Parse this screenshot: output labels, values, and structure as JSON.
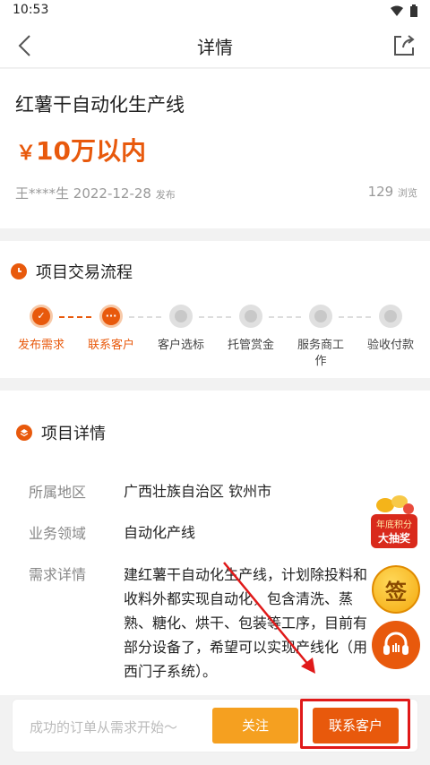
{
  "status_bar": {
    "time": "10:53"
  },
  "nav": {
    "title": "详情"
  },
  "project": {
    "title": "红薯干自动化生产线",
    "price_currency": "￥",
    "price_amount": "10万以内",
    "poster": "王****生",
    "date": "2022-12-28",
    "date_suffix": "发布",
    "views": "129",
    "views_suffix": "浏览"
  },
  "process": {
    "heading": "项目交易流程",
    "steps": [
      {
        "label": "发布需求",
        "state": "done"
      },
      {
        "label": "联系客户",
        "state": "current"
      },
      {
        "label": "客户选标",
        "state": "pending"
      },
      {
        "label": "托管赏金",
        "state": "pending"
      },
      {
        "label": "服务商工作",
        "state": "pending"
      },
      {
        "label": "验收付款",
        "state": "pending"
      }
    ]
  },
  "details": {
    "heading": "项目详情",
    "rows": [
      {
        "key": "所属地区",
        "value": "广西壮族自治区 钦州市"
      },
      {
        "key": "业务领域",
        "value": "自动化产线"
      },
      {
        "key": "需求详情",
        "value": "建红薯干自动化生产线，计划除投料和收料外都实现自动化，包含清洗、蒸熟、糖化、烘干、包装等工序，目前有部分设备了，希望可以实现产线化（用西门子系统）。"
      }
    ]
  },
  "floating": {
    "lottery_line1": "年底积分",
    "lottery_line2": "大抽奖",
    "sign_label": "签"
  },
  "bottom": {
    "hint": "成功的订单从需求开始～",
    "follow_label": "关注",
    "contact_label": "联系客户"
  },
  "colors": {
    "accent": "#e8590c",
    "follow": "#f5a020",
    "highlight": "#e01919"
  }
}
